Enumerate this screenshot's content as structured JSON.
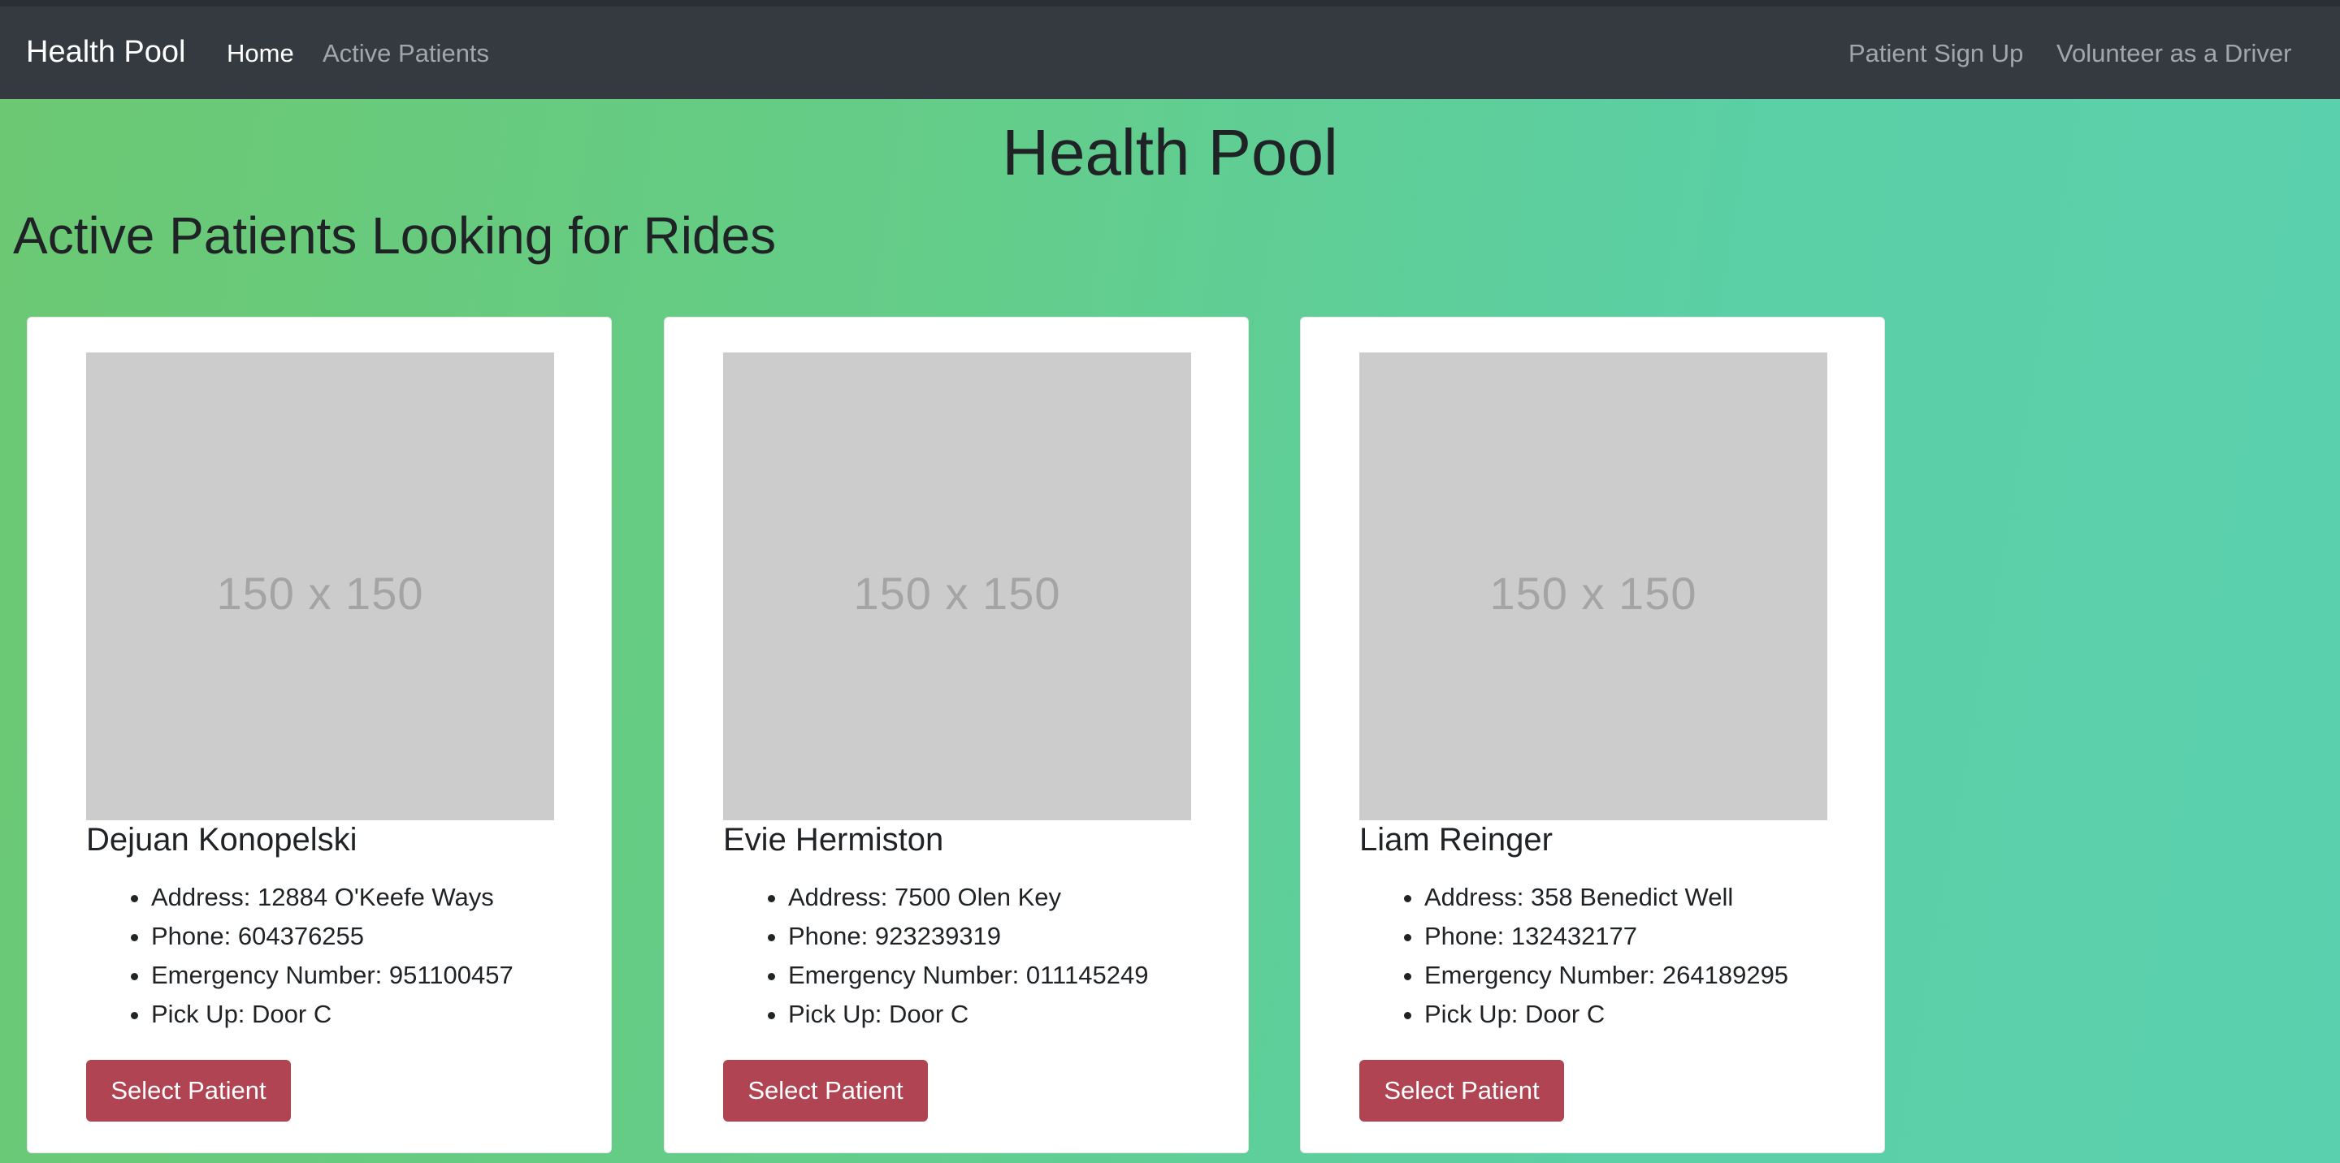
{
  "navbar": {
    "brand": "Health Pool",
    "links": {
      "home": "Home",
      "active_patients": "Active Patients",
      "patient_sign_up": "Patient Sign Up",
      "volunteer": "Volunteer as a Driver"
    }
  },
  "main": {
    "title": "Health Pool",
    "section_title": "Active Patients Looking for Rides"
  },
  "patients": [
    {
      "image_placeholder": "150 x 150",
      "name": "Dejuan Konopelski",
      "address": "Address: 12884 O'Keefe Ways",
      "phone": "Phone: 604376255",
      "emergency": "Emergency Number: 951100457",
      "pickup": "Pick Up: Door C",
      "button": "Select Patient"
    },
    {
      "image_placeholder": "150 x 150",
      "name": "Evie Hermiston",
      "address": "Address: 7500 Olen Key",
      "phone": "Phone: 923239319",
      "emergency": "Emergency Number: 011145249",
      "pickup": "Pick Up: Door C",
      "button": "Select Patient"
    },
    {
      "image_placeholder": "150 x 150",
      "name": "Liam Reinger",
      "address": "Address: 358 Benedict Well",
      "phone": "Phone: 132432177",
      "emergency": "Emergency Number: 264189295",
      "pickup": "Pick Up: Door C",
      "button": "Select Patient"
    }
  ],
  "colors": {
    "navbar": "#343a40",
    "button": "#b04452",
    "gradient_start": "#6cc872",
    "gradient_end": "#5bd0ae"
  }
}
